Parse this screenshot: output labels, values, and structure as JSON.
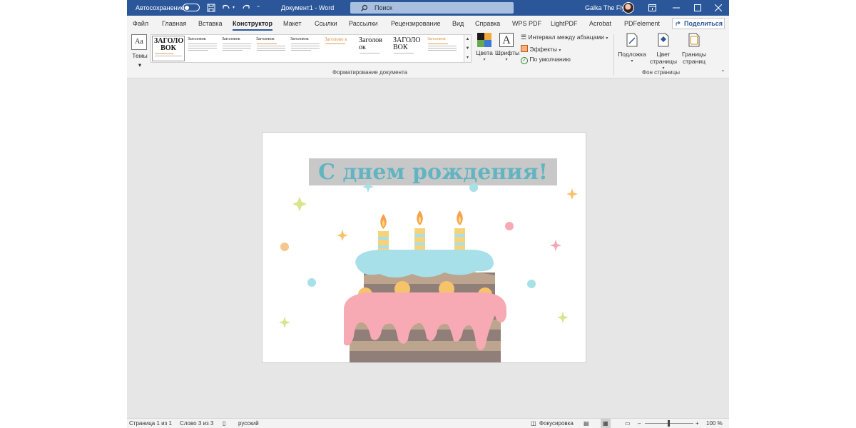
{
  "titlebar": {
    "autosave_label": "Автосохранение",
    "doc_title": "Документ1 - Word",
    "search_placeholder": "Поиск",
    "user_name": "Galka The Fly"
  },
  "tabs": [
    "Файл",
    "Главная",
    "Вставка",
    "Конструктор",
    "Макет",
    "Ссылки",
    "Рассылки",
    "Рецензирование",
    "Вид",
    "Справка",
    "WPS PDF",
    "LightPDF",
    "Acrobat",
    "PDFelement"
  ],
  "active_tab": "Конструктор",
  "share_label": "Поделиться",
  "ribbon": {
    "themes_label": "Темы",
    "themes_icon_text": "Aa",
    "style_thumbs": [
      {
        "heading": "ЗАГОЛО ВОК",
        "big": true
      },
      {
        "heading": "Заголовок"
      },
      {
        "heading": "Заголовок"
      },
      {
        "heading": "Заголовок"
      },
      {
        "heading": "Заголовок"
      },
      {
        "heading": "Заголово к",
        "orange": true
      },
      {
        "heading": "Заголов ок",
        "big": true
      },
      {
        "heading": "ЗАГОЛО ВОК",
        "big": true
      },
      {
        "heading": "Заголовок",
        "orange": true
      }
    ],
    "colors_label": "Цвета",
    "fonts_label": "Шрифты",
    "fonts_icon_text": "A",
    "paragraph_spacing_label": "Интервал между абзацами",
    "effects_label": "Эффекты",
    "default_label": "По умолчанию",
    "doc_format_group_label": "Форматирование документа",
    "watermark_label": "Подложка",
    "page_color_label": "Цвет страницы",
    "page_borders_label": "Границы страниц",
    "page_bg_group_label": "Фон страницы"
  },
  "document": {
    "heading_text": "С днем рождения!"
  },
  "status": {
    "page": "Страница 1 из 1",
    "words": "Слово 3 из 3",
    "language": "русский",
    "focus": "Фокусировка",
    "zoom": "100 %",
    "zoom_minus": "–",
    "zoom_plus": "+"
  },
  "colors": {
    "accent": "#2b579a",
    "heading": "#62b4c1",
    "cake_blue": "#a7e0e8",
    "cake_pink": "#f7aab4",
    "cake_brown": "#bca48e",
    "candle_flame": "#f6a14e"
  }
}
